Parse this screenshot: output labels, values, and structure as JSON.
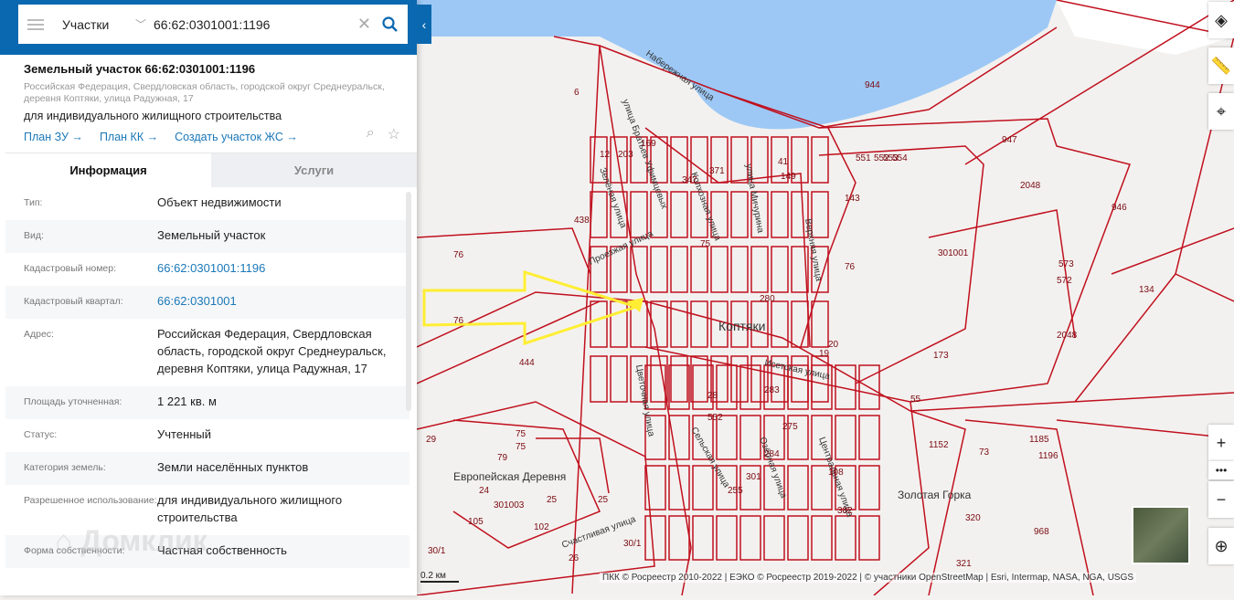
{
  "search": {
    "menu_icon": "hamburger-icon",
    "layer_select": "Участки",
    "query": "66:62:0301001:1196"
  },
  "object": {
    "title": "Земельный участок 66:62:0301001:1196",
    "address": "Российская Федерация, Свердловская область, городской округ Среднеуральск, деревня Коптяки, улица Радужная, 17",
    "use": "для индивидуального жилищного строительства",
    "links": [
      "План ЗУ →",
      "План КК →",
      "Создать участок ЖС →"
    ]
  },
  "tabs": [
    "Информация",
    "Услуги"
  ],
  "rows": [
    {
      "k": "Тип:",
      "v": "Объект недвижимости"
    },
    {
      "k": "Вид:",
      "v": "Земельный участок"
    },
    {
      "k": "Кадастровый номер:",
      "v": "66:62:0301001:1196",
      "link": true
    },
    {
      "k": "Кадастровый квартал:",
      "v": "66:62:0301001",
      "link": true
    },
    {
      "k": "Адрес:",
      "v": "Российская Федерация, Свердловская область, городской округ Среднеуральск, деревня Коптяки, улица Радужная, 17"
    },
    {
      "k": "Площадь уточненная:",
      "v": "1 221 кв. м"
    },
    {
      "k": "Статус:",
      "v": "Учтенный"
    },
    {
      "k": "Категория земель:",
      "v": "Земли населённых пунктов"
    },
    {
      "k": "Разрешенное использование:",
      "v": "для индивидуального жилищного строительства"
    },
    {
      "k": "Форма собственности:",
      "v": "Частная собственность"
    }
  ],
  "watermark": "Домклик",
  "map": {
    "places": [
      "Коптяки",
      "Европейская Деревня",
      "Золотая Горка"
    ],
    "streets": [
      "Набережная улица",
      "улица Братьев Уфимцевых",
      "Зелёная улица",
      "Колхозная улица",
      "улица Мичурина",
      "Верхняя улица",
      "Проезжая улица",
      "Исетская улица",
      "Цветочная улица",
      "Сельская улица",
      "Озёрная улица",
      "Центральная улица",
      "Счастливая улица"
    ],
    "parcels": [
      "6",
      "944",
      "947",
      "2048",
      "946",
      "301001",
      "572",
      "573",
      "134",
      "2048",
      "173",
      "55",
      "76",
      "76",
      "438",
      "12",
      "203",
      "169",
      "347",
      "371",
      "41",
      "149",
      "551",
      "552",
      "553",
      "554",
      "143",
      "75",
      "280",
      "76",
      "19",
      "20",
      "444",
      "28",
      "283",
      "552",
      "284",
      "275",
      "301",
      "108",
      "255",
      "382",
      "1152",
      "73",
      "1185",
      "1196",
      "320",
      "968",
      "321",
      "29",
      "75",
      "75",
      "79",
      "24",
      "301003",
      "25",
      "25",
      "105",
      "102",
      "26",
      "30/1",
      "30/1"
    ],
    "scale": "0.2 км",
    "attribution": "ПКК © Росреестр 2010-2022 | ЕЭКО © Росреестр 2019-2022 | © участники OpenStreetMap | Esri, Intermap, NASA, NGA, USGS",
    "colors": {
      "boundary": "#c0101e",
      "water": "#9dc8f5",
      "highlight": "#ffee33"
    }
  }
}
